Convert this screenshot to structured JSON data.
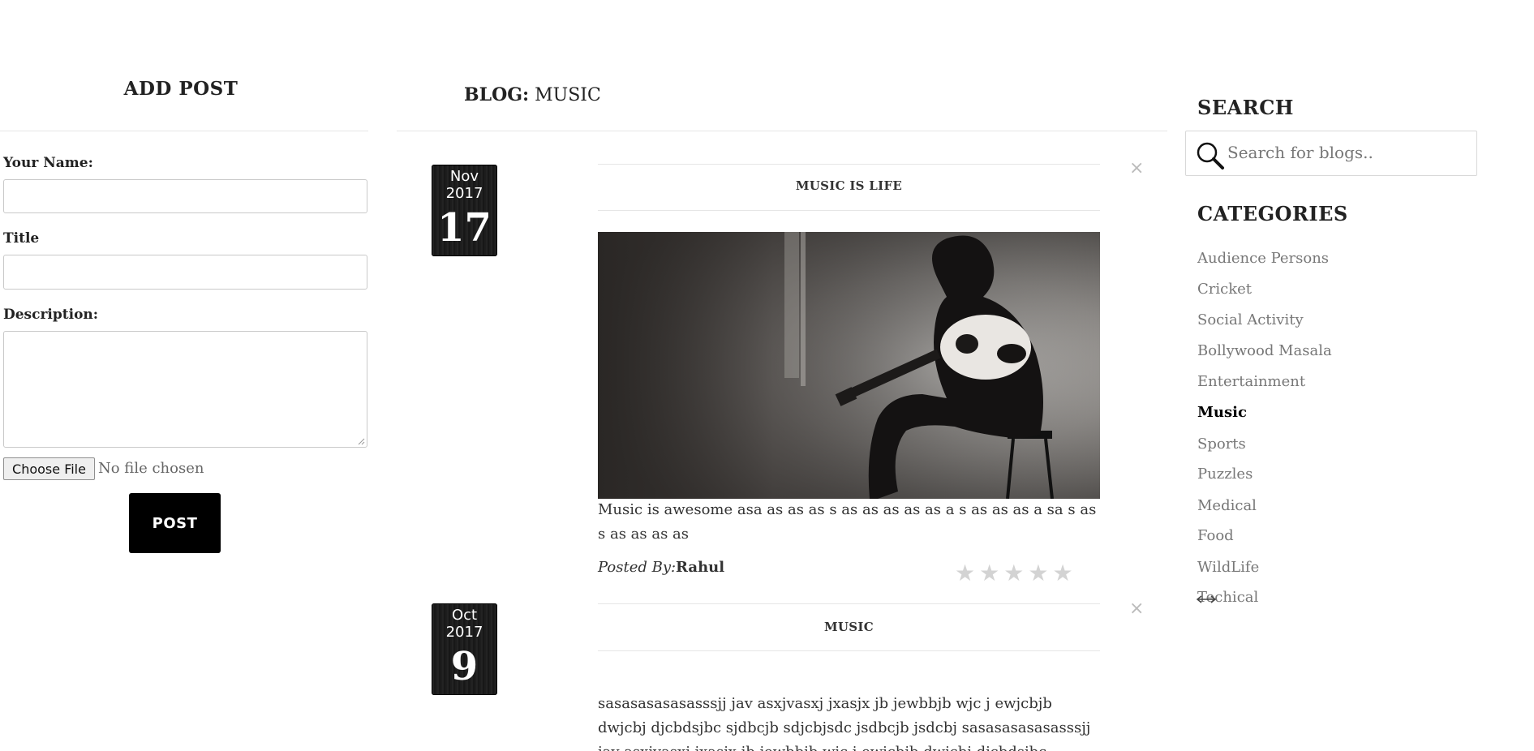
{
  "add_post": {
    "title": "ADD POST",
    "name_label": "Your Name:",
    "title_label": "Title",
    "description_label": "Description:",
    "file_button": "Choose File",
    "file_status": "No file chosen",
    "post_button": "POST"
  },
  "blog": {
    "heading_prefix": "BLOG:",
    "heading_category": "MUSIC",
    "posts": [
      {
        "month_year": "Nov 2017",
        "day": "17",
        "title": "MUSIC IS LIFE",
        "body": "Music is awesome asa as as as s as as as as as a s as as as a sa s as s as as as as",
        "posted_by_label": "Posted By:",
        "author": "Rahul",
        "rating": 0
      },
      {
        "month_year": "Oct 2017",
        "day": "9",
        "title": "MUSIC",
        "body": "sasasasasasasssjj jav asxjvasxj jxasjx jb jewbbjb wjc j ewjcbjb dwjcbj djcbdsjbc sjdbcjb sdjcbjsdc jsdbcjb jsdcbj sasasasasasasssjj jav asxjvasxj jxasjx jb jewbbjb wjc j ewjcbjb dwjcbj djcbdsjbc sjdbcjb sdjcbjsdc jsdbcjb"
      }
    ],
    "close_glyph": "×",
    "star_glyph": "★"
  },
  "sidebar": {
    "search_heading": "SEARCH",
    "search_placeholder": "Search for blogs..",
    "categories_heading": "CATEGORIES",
    "categories": [
      "Audience Persons",
      "Cricket",
      "Social Activity",
      "Bollywood Masala",
      "Entertainment",
      "Music",
      "Sports",
      "Puzzles",
      "Medical",
      "Food",
      "WildLife",
      "Techical"
    ],
    "active_category": "Music"
  },
  "icons": {
    "search": "search-icon",
    "close": "close-icon",
    "star": "star-icon"
  }
}
